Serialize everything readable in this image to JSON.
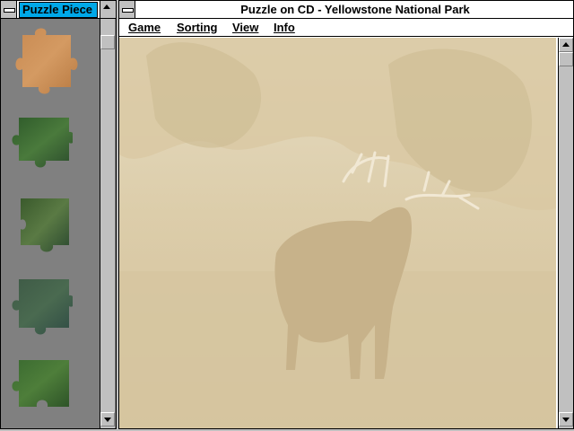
{
  "pieces_window": {
    "title": "Puzzle Piece"
  },
  "main_window": {
    "title": "Puzzle on CD - Yellowstone National Park"
  },
  "menu": [
    {
      "label": "Game"
    },
    {
      "label": "Sorting"
    },
    {
      "label": "View"
    },
    {
      "label": "Info"
    }
  ],
  "colors": {
    "puzzle_sepia": "#d8c8a6",
    "title_highlight": "#00a8e8",
    "palette_bg": "#808080"
  }
}
